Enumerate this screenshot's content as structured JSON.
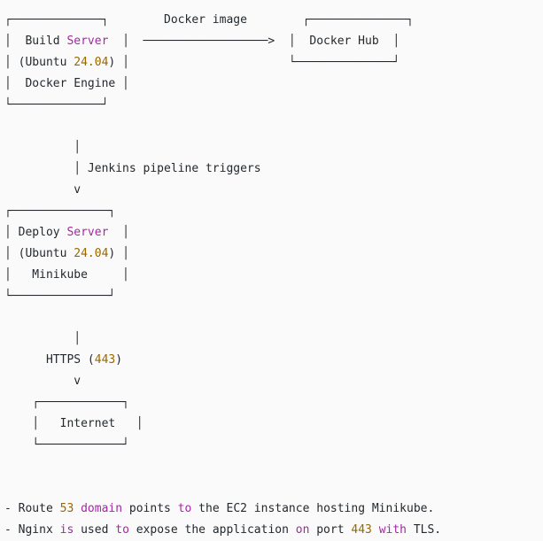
{
  "colors": {
    "background": "#fafafa",
    "text": "#24292e",
    "keyword": "#a626a4",
    "number": "#986801"
  },
  "lines": [
    [
      {
        "t": "┌─────────────┐        Docker image        ┌──────────────┐",
        "c": ""
      }
    ],
    [
      {
        "t": "│  Build ",
        "c": ""
      },
      {
        "t": "Server",
        "c": "kw"
      },
      {
        "t": "  │  ──────────────────>  │  Docker Hub  │",
        "c": ""
      }
    ],
    [
      {
        "t": "│ (Ubuntu ",
        "c": ""
      },
      {
        "t": "24.04",
        "c": "num"
      },
      {
        "t": ") │                       └──────────────┘",
        "c": ""
      }
    ],
    [
      {
        "t": "│  Docker Engine │",
        "c": ""
      }
    ],
    [
      {
        "t": "└─────────────┘",
        "c": ""
      }
    ],
    [
      {
        "t": "",
        "c": ""
      }
    ],
    [
      {
        "t": "          │",
        "c": ""
      }
    ],
    [
      {
        "t": "          │ Jenkins pipeline triggers",
        "c": ""
      }
    ],
    [
      {
        "t": "          v",
        "c": ""
      }
    ],
    [
      {
        "t": "┌──────────────┐",
        "c": ""
      }
    ],
    [
      {
        "t": "│ Deploy ",
        "c": ""
      },
      {
        "t": "Server",
        "c": "kw"
      },
      {
        "t": "  │",
        "c": ""
      }
    ],
    [
      {
        "t": "│ (Ubuntu ",
        "c": ""
      },
      {
        "t": "24.04",
        "c": "num"
      },
      {
        "t": ") │",
        "c": ""
      }
    ],
    [
      {
        "t": "│   Minikube     │",
        "c": ""
      }
    ],
    [
      {
        "t": "└──────────────┘",
        "c": ""
      }
    ],
    [
      {
        "t": "",
        "c": ""
      }
    ],
    [
      {
        "t": "          │",
        "c": ""
      }
    ],
    [
      {
        "t": "      HTTPS (",
        "c": ""
      },
      {
        "t": "443",
        "c": "num"
      },
      {
        "t": ")",
        "c": ""
      }
    ],
    [
      {
        "t": "          v",
        "c": ""
      }
    ],
    [
      {
        "t": "    ┌────────────┐",
        "c": ""
      }
    ],
    [
      {
        "t": "    │   Internet   │",
        "c": ""
      }
    ],
    [
      {
        "t": "    └────────────┘",
        "c": ""
      }
    ],
    [
      {
        "t": "",
        "c": ""
      }
    ],
    [
      {
        "t": "",
        "c": ""
      }
    ],
    [
      {
        "t": "- Route ",
        "c": ""
      },
      {
        "t": "53",
        "c": "num"
      },
      {
        "t": " ",
        "c": ""
      },
      {
        "t": "domain",
        "c": "kw"
      },
      {
        "t": " points ",
        "c": ""
      },
      {
        "t": "to",
        "c": "kw"
      },
      {
        "t": " the EC2 instance hosting Minikube.",
        "c": ""
      }
    ],
    [
      {
        "t": "- Nginx ",
        "c": ""
      },
      {
        "t": "is",
        "c": "kw"
      },
      {
        "t": " used ",
        "c": ""
      },
      {
        "t": "to",
        "c": "kw"
      },
      {
        "t": " expose the application ",
        "c": ""
      },
      {
        "t": "on",
        "c": "kw"
      },
      {
        "t": " port ",
        "c": ""
      },
      {
        "t": "443",
        "c": "num"
      },
      {
        "t": " ",
        "c": ""
      },
      {
        "t": "with",
        "c": "kw"
      },
      {
        "t": " TLS.",
        "c": ""
      }
    ]
  ]
}
